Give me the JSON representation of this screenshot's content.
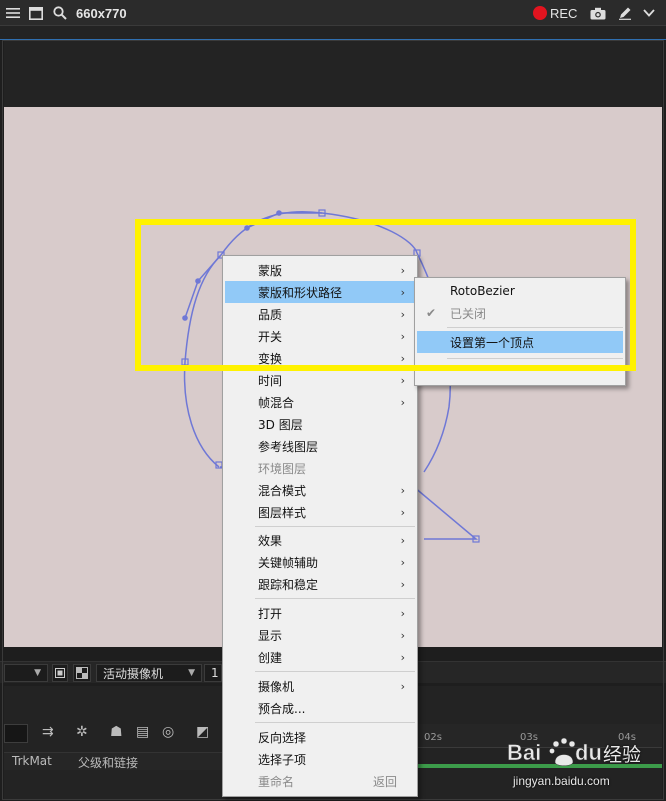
{
  "recorder": {
    "title": "660x770",
    "rec_label": "REC",
    "rec_color": "#e2141f",
    "icons": [
      "menu-icon",
      "window-icon",
      "search-icon",
      "camera-icon",
      "pencil-icon",
      "dropdown-icon"
    ]
  },
  "viewer": {
    "camera_label": "活动摄像机",
    "views_value": "1"
  },
  "timeline": {
    "columns": [
      "TrkMat",
      "父级和链接"
    ],
    "ruler_ticks": [
      "02s",
      "03s",
      "04s"
    ]
  },
  "context_menu": {
    "items": [
      {
        "label": "蒙版",
        "submenu": true
      },
      {
        "label": "蒙版和形状路径",
        "submenu": true,
        "highlighted": true
      },
      {
        "label": "品质",
        "submenu": true
      },
      {
        "label": "开关",
        "submenu": true
      },
      {
        "label": "变换",
        "submenu": true
      },
      {
        "label": "时间",
        "submenu": true
      },
      {
        "label": "帧混合",
        "submenu": true
      },
      {
        "label": "3D 图层"
      },
      {
        "label": "参考线图层"
      },
      {
        "label": "环境图层",
        "disabled": true
      },
      {
        "label": "混合模式",
        "submenu": true
      },
      {
        "label": "图层样式",
        "submenu": true
      },
      {
        "label": "效果",
        "submenu": true
      },
      {
        "label": "关键帧辅助",
        "submenu": true
      },
      {
        "label": "跟踪和稳定",
        "submenu": true
      },
      {
        "label": "打开",
        "submenu": true
      },
      {
        "label": "显示",
        "submenu": true
      },
      {
        "label": "创建",
        "submenu": true
      },
      {
        "label": "摄像机",
        "submenu": true
      },
      {
        "label": "预合成..."
      },
      {
        "label": "反向选择"
      },
      {
        "label": "选择子项"
      },
      {
        "label": "重命名",
        "disabled": true,
        "shortcut": "返回"
      }
    ]
  },
  "submenu": {
    "items": [
      {
        "label": "RotoBezier"
      },
      {
        "label": "已关闭",
        "checked": true,
        "disabled": true
      },
      {
        "label": "设置第一个顶点",
        "highlighted": true
      }
    ]
  },
  "watermark": {
    "brand_cn": "经验",
    "url": "jingyan.baidu.com"
  },
  "colors": {
    "highlight_box": "#fff200",
    "menu_highlight": "#91c9f7",
    "canvas_bg": "#d8cbcb",
    "mask_path": "#6f78d6"
  }
}
